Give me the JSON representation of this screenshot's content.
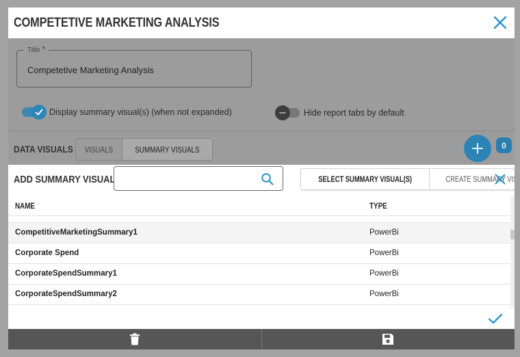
{
  "dialog": {
    "title": "COMPETETIVE MARKETING ANALYSIS",
    "close_icon": "close-icon"
  },
  "form": {
    "title_label": "Title",
    "required_mark": "*",
    "title_value": "Competetive Marketing Analysis",
    "display_summary_toggle": {
      "label": "Display summary visual(s) (when not expanded)",
      "checked": true
    },
    "hide_tabs_toggle": {
      "label": "Hide report tabs by default",
      "checked": false
    }
  },
  "data_visuals": {
    "label": "DATA VISUALS",
    "tabs": [
      {
        "label": "VISUALS",
        "active": false
      },
      {
        "label": "SUMMARY VISUALS",
        "active": true
      }
    ],
    "add_icon": "plus-icon",
    "count": "0"
  },
  "add_summary": {
    "title": "ADD SUMMARY VISUAL(S)",
    "search": {
      "value": "",
      "placeholder": "",
      "icon": "search-icon"
    },
    "select_button": "SELECT SUMMARY VISUAL(S)",
    "create_button": "CREATE SUMMARY VISUAL",
    "close_icon": "close-icon"
  },
  "table": {
    "columns": [
      "NAME",
      "TYPE"
    ],
    "rows": [
      {
        "name": "",
        "type": ""
      },
      {
        "name": "CompetitiveMarketingSummary1",
        "type": "PowerBi"
      },
      {
        "name": "Corporate Spend",
        "type": "PowerBi"
      },
      {
        "name": "CorporateSpendSummary1",
        "type": "PowerBi"
      },
      {
        "name": "CorporateSpendSummary2",
        "type": "PowerBi"
      }
    ]
  },
  "footer": {
    "delete_icon": "trash-icon",
    "save_icon": "save-icon"
  },
  "colors": {
    "accent": "#2e86b8",
    "footer": "#565656",
    "overlay": "#9c9c9c"
  }
}
